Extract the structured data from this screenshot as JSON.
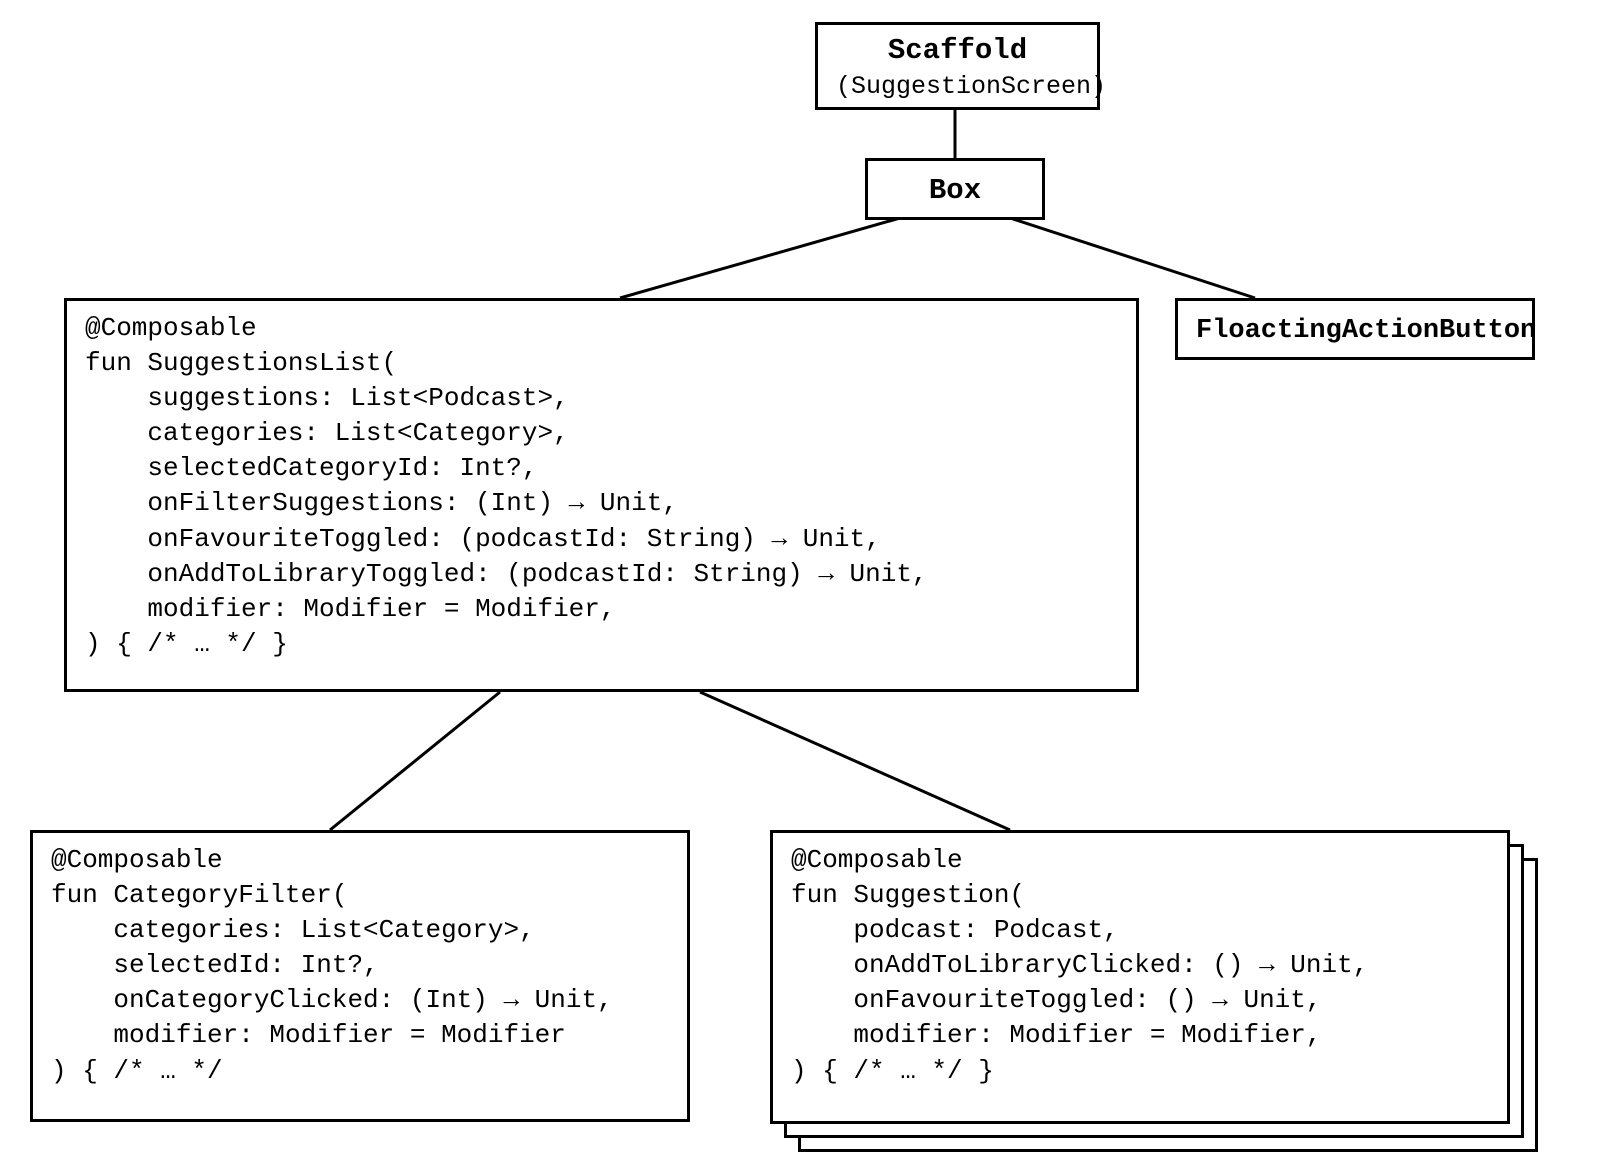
{
  "scaffold": {
    "title": "Scaffold",
    "subtitle": "(SuggestionScreen)"
  },
  "box_node": {
    "label": "Box"
  },
  "fab": {
    "label": "FloactingActionButton"
  },
  "suggestions_list": {
    "code": "@Composable\nfun SuggestionsList(\n    suggestions: List<Podcast>,\n    categories: List<Category>,\n    selectedCategoryId: Int?,\n    onFilterSuggestions: (Int) → Unit,\n    onFavouriteToggled: (podcastId: String) → Unit,\n    onAddToLibraryToggled: (podcastId: String) → Unit,\n    modifier: Modifier = Modifier,\n) { /* … */ }"
  },
  "category_filter": {
    "code": "@Composable\nfun CategoryFilter(\n    categories: List<Category>,\n    selectedId: Int?,\n    onCategoryClicked: (Int) → Unit,\n    modifier: Modifier = Modifier\n) { /* … */"
  },
  "suggestion": {
    "code": "@Composable\nfun Suggestion(\n    podcast: Podcast,\n    onAddToLibraryClicked: () → Unit,\n    onFavouriteToggled: () → Unit,\n    modifier: Modifier = Modifier,\n) { /* … */ }"
  }
}
